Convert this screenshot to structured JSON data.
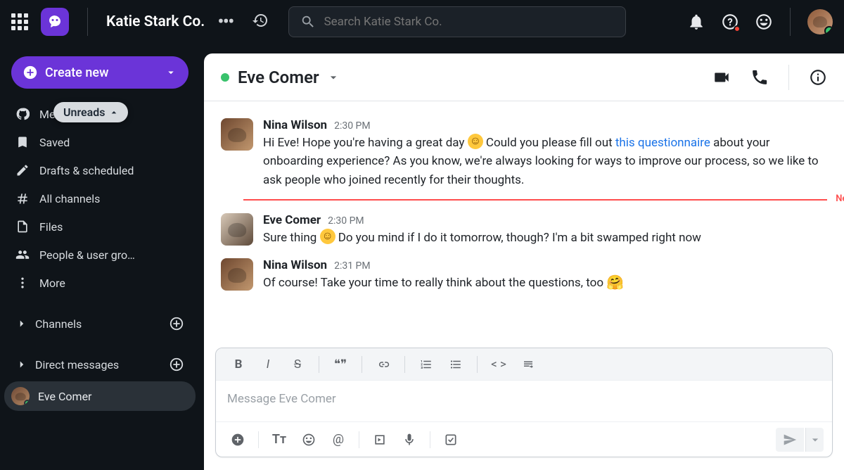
{
  "topbar": {
    "workspace_name": "Katie Stark Co.",
    "search_placeholder": "Search Katie Stark Co."
  },
  "sidebar": {
    "create_label": "Create new",
    "unreads_pill": "Unreads",
    "items": [
      {
        "label": "Mentioned ti…"
      },
      {
        "label": "Saved"
      },
      {
        "label": "Drafts & scheduled"
      },
      {
        "label": "All channels"
      },
      {
        "label": "Files"
      },
      {
        "label": "People & user gro…"
      },
      {
        "label": "More"
      }
    ],
    "sections": {
      "channels_label": "Channels",
      "dms_label": "Direct messages"
    },
    "active_dm": "Eve Comer"
  },
  "chat": {
    "title": "Eve Comer",
    "new_label": "New",
    "messages": [
      {
        "author": "Nina Wilson",
        "time": "2:30 PM",
        "text_before_emoji": "Hi Eve! Hope you're having a great day ",
        "text_after_emoji_before_link": " Could you please fill out ",
        "link_text": "this questionnaire",
        "text_after_link": " about your onboarding experience? As you know, we're always looking for ways to improve our process, so we like to ask people who joined recently for their thoughts."
      },
      {
        "author": "Eve Comer",
        "time": "2:30 PM",
        "text_before_emoji": "Sure thing ",
        "text_after_emoji": " Do you mind if I do it tomorrow, though? I'm a bit swamped right now"
      },
      {
        "author": "Nina Wilson",
        "time": "2:31 PM",
        "text_before_emoji": "Of course! Take your time to really think about the questions, too "
      }
    ]
  },
  "composer": {
    "placeholder": "Message Eve Comer"
  }
}
